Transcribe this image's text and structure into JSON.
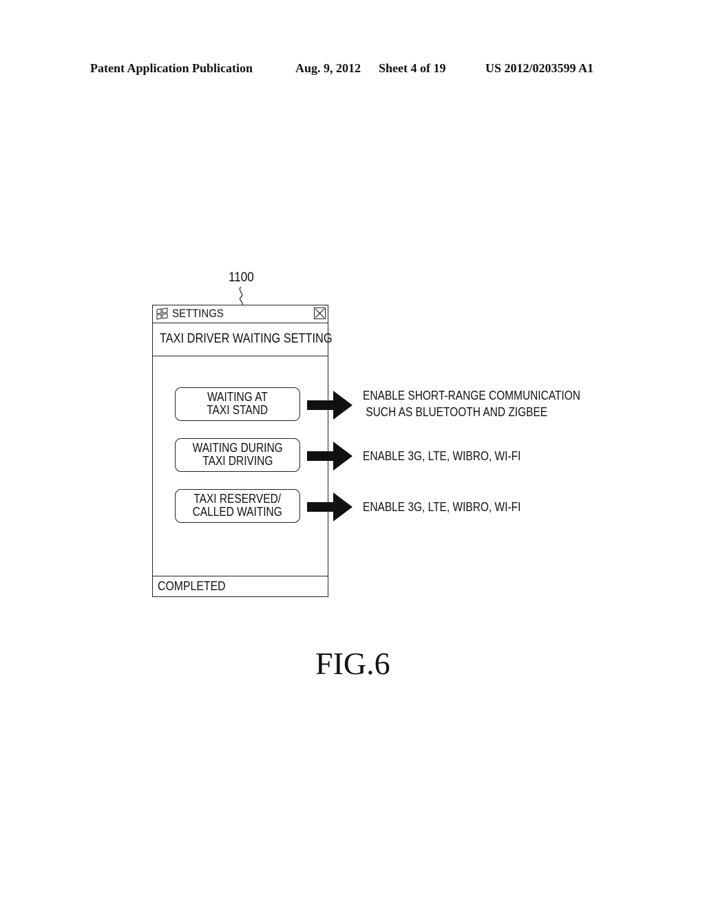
{
  "header": {
    "publication": "Patent Application Publication",
    "date": "Aug. 9, 2012",
    "sheet": "Sheet 4 of 19",
    "number": "US 2012/0203599 A1"
  },
  "diagram": {
    "reference_numeral": "1100",
    "window": {
      "logo_icon": "windows-flag-icon",
      "title": "SETTINGS",
      "close_icon": "close-icon",
      "subheading": "TAXI DRIVER WAITING SETTING",
      "options": [
        {
          "line1": "WAITING AT",
          "line2": "TAXI STAND"
        },
        {
          "line1": "WAITING DURING",
          "line2": "TAXI DRIVING"
        },
        {
          "line1": "TAXI RESERVED/",
          "line2": "CALLED WAITING"
        }
      ],
      "footer_label": "COMPLETED"
    },
    "results": [
      {
        "line1": "ENABLE SHORT-RANGE COMMUNICATION",
        "line2": " SUCH AS BLUETOOTH AND ZIGBEE"
      },
      {
        "line1": "ENABLE 3G, LTE, WIBRO, WI-FI",
        "line2": ""
      },
      {
        "line1": "ENABLE 3G, LTE, WIBRO, WI-FI",
        "line2": ""
      }
    ],
    "arrow_icon": "right-arrow-icon"
  },
  "figure_label": "FIG.6"
}
